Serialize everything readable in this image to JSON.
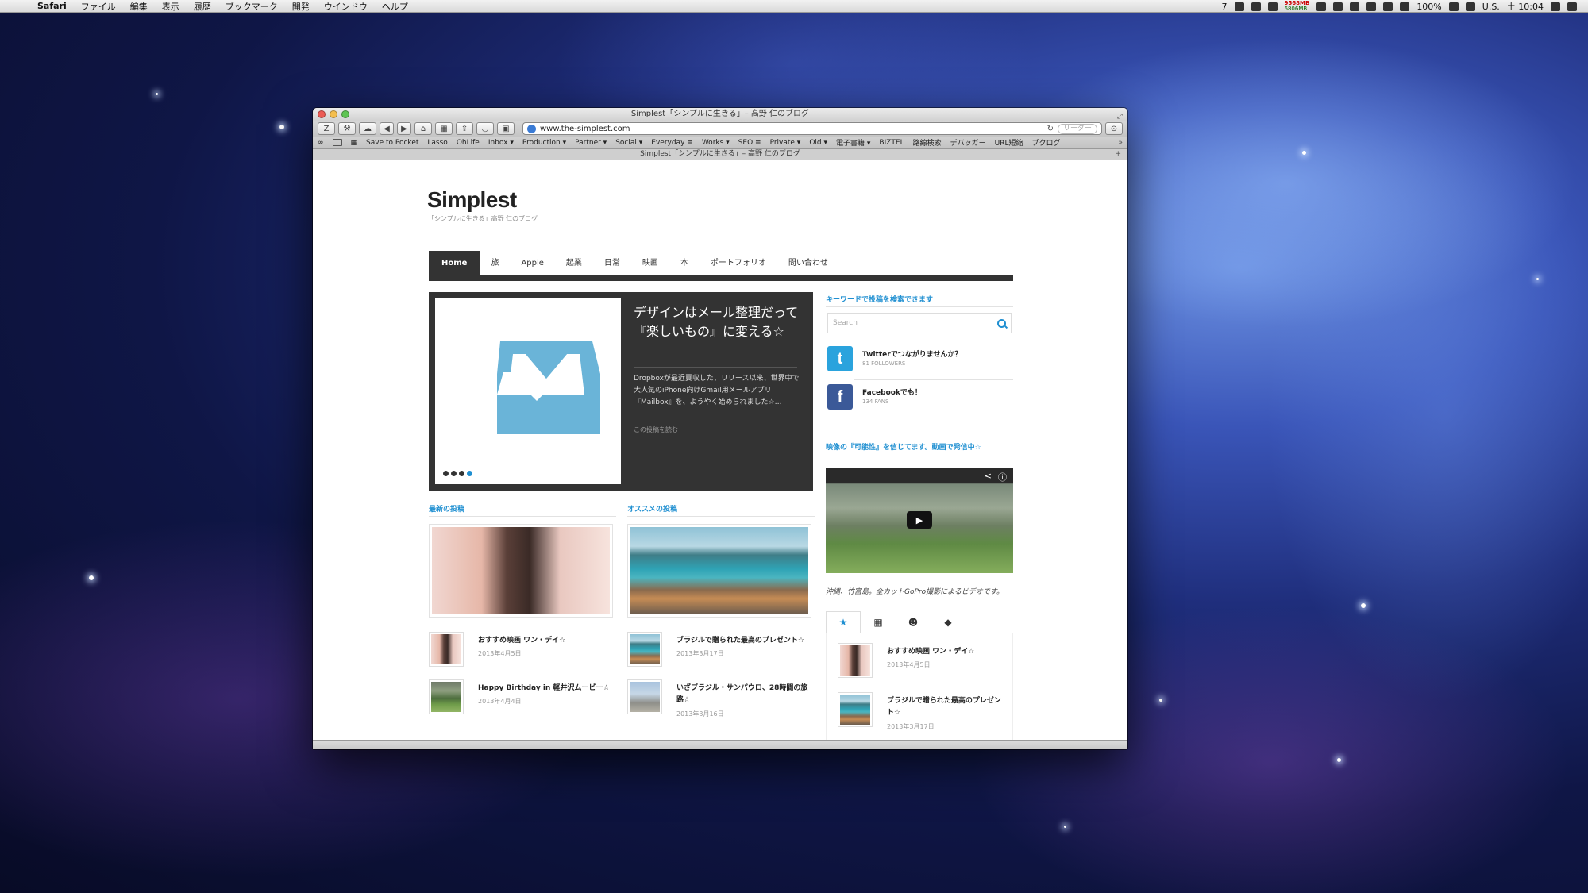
{
  "menubar": {
    "app": "Safari",
    "items": [
      "ファイル",
      "編集",
      "表示",
      "履歴",
      "ブックマーク",
      "開発",
      "ウインドウ",
      "ヘルプ"
    ],
    "status": {
      "mem_used": "9568MB",
      "mem_free": "6806MB",
      "battery": "100%",
      "input": "U.S.",
      "clock": "土 10:04",
      "badge": "7"
    }
  },
  "window": {
    "title": "Simplest「シンプルに生きる」– 高野 仁のブログ",
    "url": "www.the-simplest.com",
    "reader_label": "リーダー",
    "bookmarks": [
      "Save to Pocket",
      "Lasso",
      "OhLife",
      "Inbox ▾",
      "Production ▾",
      "Partner ▾",
      "Social ▾",
      "Everyday ≡",
      "Works ▾",
      "SEO ≡",
      "Private ▾",
      "Old ▾",
      "電子書籍 ▾",
      "BIZTEL",
      "路線検索",
      "デバッガー",
      "URL短縮",
      "ブクログ"
    ],
    "tab_title": "Simplest「シンプルに生きる」– 高野 仁のブログ"
  },
  "blog": {
    "title": "Simplest",
    "subtitle": "「シンプルに生きる」高野 仁のブログ",
    "nav": [
      "Home",
      "旅",
      "Apple",
      "起業",
      "日常",
      "映画",
      "本",
      "ポートフォリオ",
      "問い合わせ"
    ],
    "slider": {
      "title": "デザインはメール整理だって『楽しいもの』に変える☆",
      "excerpt": "Dropboxが最近買収した、リリース以来、世界中で大人気のiPhone向けGmail用メールアプリ『Mailbox』を、ようやく始められました☆…",
      "more": "この投稿を読む",
      "dot_count": 4,
      "active_dot": 4
    },
    "latest": {
      "heading": "最新の投稿",
      "posts": [
        {
          "title": "おすすめ映画 ワン・デイ☆",
          "date": "2013年4月5日"
        },
        {
          "title": "Happy Birthday in 軽井沢ムービー☆",
          "date": "2013年4月4日"
        }
      ]
    },
    "recommended": {
      "heading": "オススメの投稿",
      "posts": [
        {
          "title": "ブラジルで贈られた最高のプレゼント☆",
          "date": "2013年3月17日"
        },
        {
          "title": "いざブラジル・サンパウロ、28時間の旅路☆",
          "date": "2013年3月16日"
        }
      ]
    },
    "sidebar": {
      "search_heading": "キーワードで投稿を検索できます",
      "search_placeholder": "Search",
      "twitter": {
        "name": "Twitterでつながりませんか？",
        "count": "81 FOLLOWERS"
      },
      "facebook": {
        "name": "Facebookでも！",
        "count": "134 FANS"
      },
      "video_heading": "映像の『可能性』を信じてます。動画で発信中☆",
      "video_caption": "沖縄、竹富島。全カットGoPro撮影によるビデオです。",
      "tab_posts": [
        {
          "title": "おすすめ映画 ワン・デイ☆",
          "date": "2013年4月5日"
        },
        {
          "title": "ブラジルで贈られた最高のプレゼント☆",
          "date": "2013年3月17日"
        }
      ]
    }
  },
  "colors": {
    "accent": "#1f8fd1",
    "dark": "#333333",
    "mailbox": "#6ab4d8"
  }
}
